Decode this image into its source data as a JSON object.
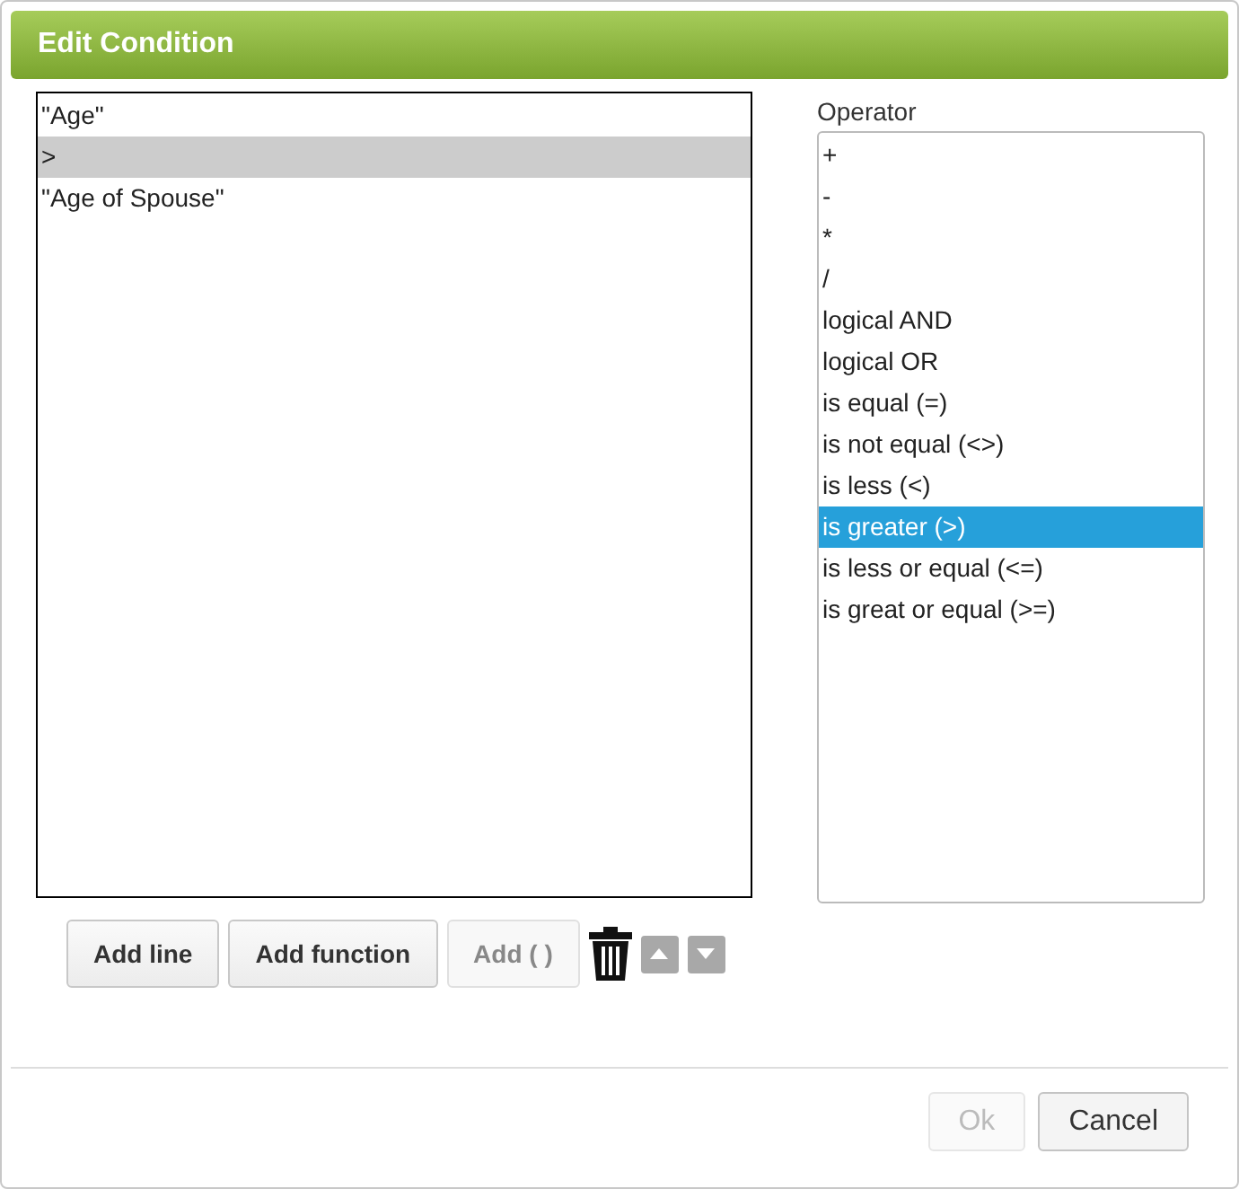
{
  "dialog": {
    "title": "Edit Condition"
  },
  "expression": [
    {
      "text": "\"Age\"",
      "selected": false
    },
    {
      "text": ">",
      "selected": true
    },
    {
      "text": "\"Age of Spouse\"",
      "selected": false
    }
  ],
  "operator": {
    "label": "Operator",
    "items": [
      {
        "text": "+",
        "selected": false
      },
      {
        "text": "-",
        "selected": false
      },
      {
        "text": "*",
        "selected": false
      },
      {
        "text": "/",
        "selected": false
      },
      {
        "text": "logical AND",
        "selected": false
      },
      {
        "text": "logical OR",
        "selected": false
      },
      {
        "text": "is equal (=)",
        "selected": false
      },
      {
        "text": "is not equal (<>)",
        "selected": false
      },
      {
        "text": "is less (<)",
        "selected": false
      },
      {
        "text": "is greater (>)",
        "selected": true
      },
      {
        "text": "is less or equal (<=)",
        "selected": false
      },
      {
        "text": "is great or equal (>=)",
        "selected": false
      }
    ]
  },
  "tools": [
    {
      "label": "Add line",
      "disabled": false
    },
    {
      "label": "Add function",
      "disabled": false
    },
    {
      "label": "Add ( )",
      "disabled": true
    }
  ],
  "footer": [
    {
      "label": "Ok",
      "disabled": true
    },
    {
      "label": "Cancel",
      "disabled": false
    }
  ]
}
